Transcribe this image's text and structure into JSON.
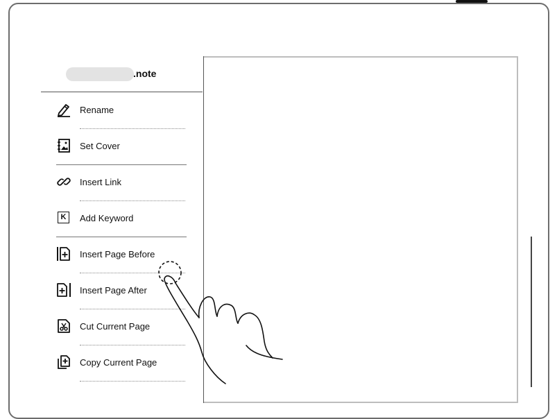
{
  "menu": {
    "filename_ext": ".note",
    "items": [
      {
        "label": "Rename",
        "icon": "pencil-icon"
      },
      {
        "label": "Set Cover",
        "icon": "cover-image-icon"
      },
      {
        "label": "Insert Link",
        "icon": "link-icon"
      },
      {
        "label": "Add Keyword",
        "icon": "keyword-k-icon"
      },
      {
        "label": "Insert Page Before",
        "icon": "insert-page-before-icon"
      },
      {
        "label": "Insert Page After",
        "icon": "insert-page-after-icon"
      },
      {
        "label": "Cut Current Page",
        "icon": "cut-page-icon"
      },
      {
        "label": "Copy Current Page",
        "icon": "copy-page-icon"
      }
    ]
  },
  "keyword_icon_letter": "K"
}
